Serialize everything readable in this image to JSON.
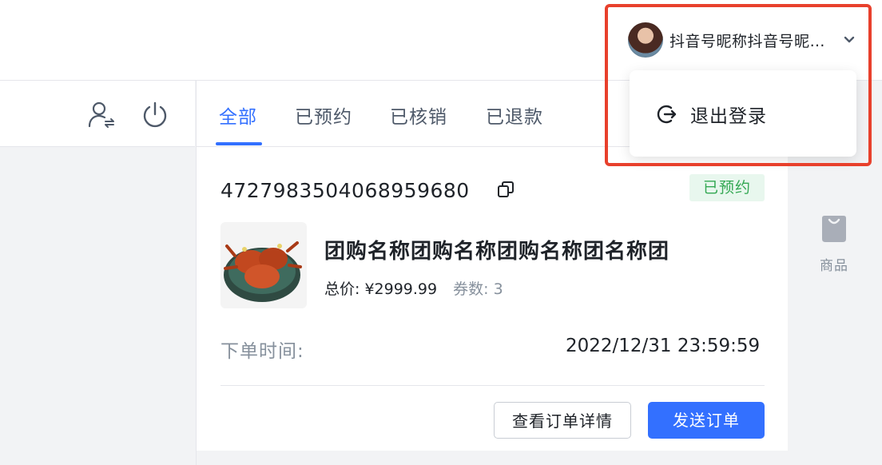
{
  "header": {
    "username": "抖音号昵称抖音号昵称抖音号昵称",
    "dropdown": {
      "logout_label": "退出登录"
    }
  },
  "tabs": [
    {
      "label": "全部",
      "active": true
    },
    {
      "label": "已预约",
      "active": false
    },
    {
      "label": "已核销",
      "active": false
    },
    {
      "label": "已退款",
      "active": false
    }
  ],
  "order": {
    "id": "4727983504068959680",
    "status": "已预约",
    "product_name": "团购名称团购名称团购名称团名称团",
    "total_price_label": "总价:",
    "total_price": "¥2999.99",
    "voucher_label": "券数:",
    "voucher_count": "3",
    "time_label": "下单时间:",
    "time_value": "2022/12/31 23:59:59",
    "detail_button": "查看订单详情",
    "send_button": "发送订单"
  },
  "right_rail": {
    "items": [
      {
        "label": "商品",
        "icon": "bag-icon"
      }
    ]
  },
  "colors": {
    "accent": "#3370ff",
    "status_green": "#34a853",
    "status_bg": "#e8f7ee",
    "highlight": "#e8402c"
  }
}
